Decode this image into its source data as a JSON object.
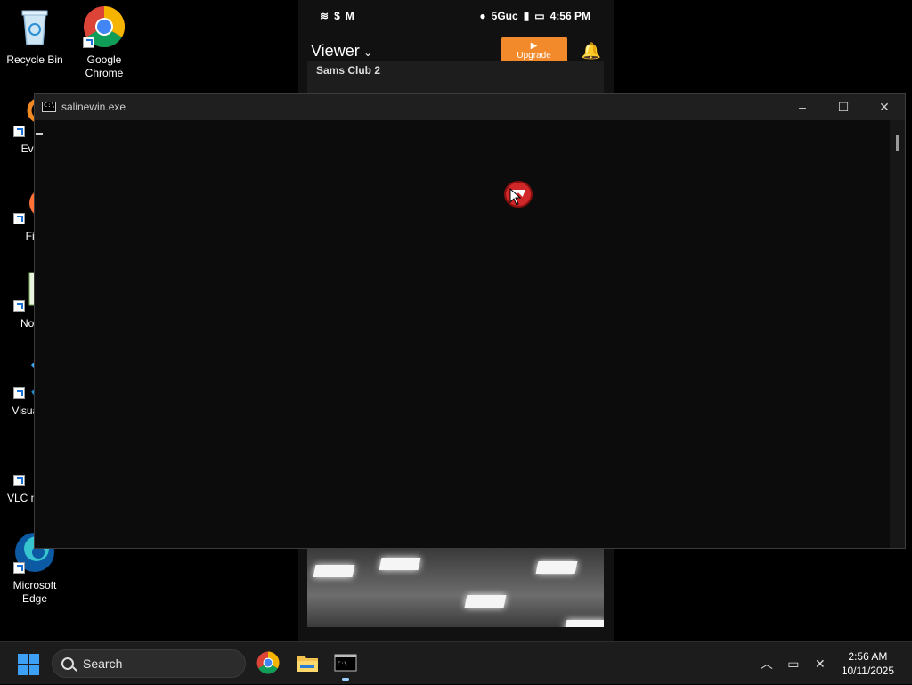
{
  "desktop": {
    "icons": [
      {
        "label": "Recycle Bin"
      },
      {
        "label": "Google Chrome"
      },
      {
        "label": "Every"
      },
      {
        "label": "Fire"
      },
      {
        "label": "Notep"
      },
      {
        "label": "Visual Co"
      },
      {
        "label": "VLC m play"
      },
      {
        "label": "Microsoft Edge"
      }
    ]
  },
  "phone": {
    "status_right": "5Guc",
    "status_time": "4:56 PM",
    "app_title": "Viewer",
    "upgrade_label": "Upgrade",
    "camera_title": "Sams Club 2"
  },
  "console": {
    "title": "salinewin.exe",
    "minimize": "–",
    "maximize": "☐",
    "close": "✕"
  },
  "taskbar": {
    "search_label": "Search",
    "time": "2:56 AM",
    "date": "10/11/2025"
  },
  "colors": {
    "upgrade": "#f28a2b",
    "start": "#3ea0f5",
    "console_bg": "#0c0c0c"
  }
}
